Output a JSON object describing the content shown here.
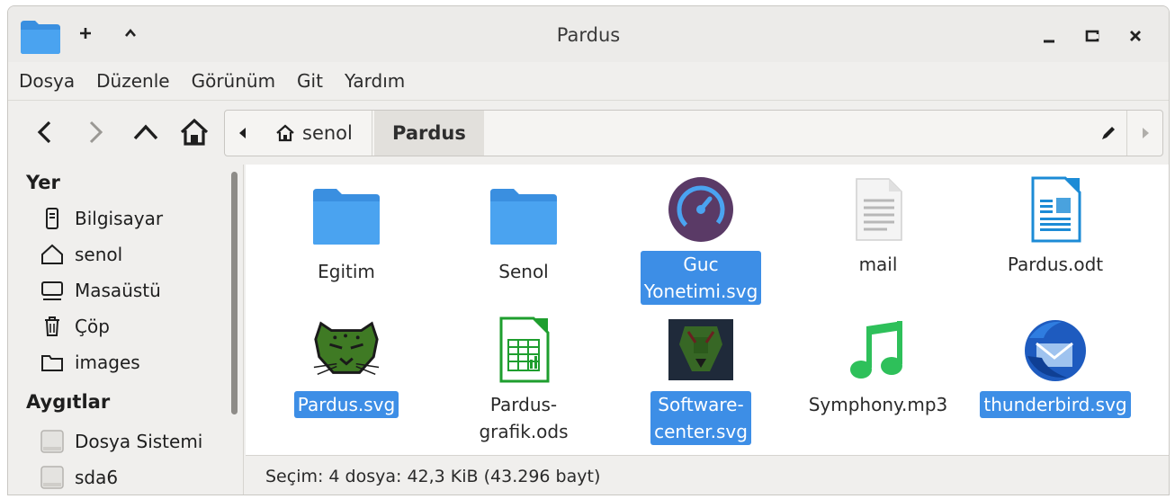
{
  "window": {
    "title": "Pardus",
    "new_tab_label": "+",
    "up_label": "^"
  },
  "menu": [
    "Dosya",
    "Düzenle",
    "Görünüm",
    "Git",
    "Yardım"
  ],
  "pathbar": {
    "crumbs": [
      {
        "label": "senol",
        "icon": "home-icon"
      },
      {
        "label": "Pardus",
        "active": true
      }
    ]
  },
  "sidebar": {
    "sections": [
      {
        "title": "Yer",
        "items": [
          {
            "label": "Bilgisayar",
            "icon": "computer-icon"
          },
          {
            "label": "senol",
            "icon": "home-icon"
          },
          {
            "label": "Masaüstü",
            "icon": "desktop-icon"
          },
          {
            "label": "Çöp",
            "icon": "trash-icon"
          },
          {
            "label": "images",
            "icon": "folder-icon"
          }
        ]
      },
      {
        "title": "Aygıtlar",
        "items": [
          {
            "label": "Dosya Sistemi",
            "icon": "drive-icon"
          },
          {
            "label": "sda6",
            "icon": "drive-icon"
          }
        ]
      }
    ]
  },
  "files": [
    {
      "name": "Egitim",
      "type": "folder",
      "selected": false
    },
    {
      "name": "Senol",
      "type": "folder",
      "selected": false
    },
    {
      "name": "Guc Yonetimi.svg",
      "line1": "Guc",
      "line2": "Yonetimi.svg",
      "type": "gauge",
      "selected": true
    },
    {
      "name": "mail",
      "type": "text",
      "selected": false
    },
    {
      "name": "Pardus.odt",
      "type": "writer",
      "selected": false
    },
    {
      "name": "Pardus.svg",
      "type": "panther",
      "selected": true
    },
    {
      "name": "Pardus-grafik.ods",
      "line1": "Pardus-",
      "line2": "grafik.ods",
      "type": "calc",
      "selected": false
    },
    {
      "name": "Software-center.svg",
      "line1": "Software-",
      "line2": "center.svg",
      "type": "software",
      "selected": true
    },
    {
      "name": "Symphony.mp3",
      "type": "music",
      "selected": false
    },
    {
      "name": "thunderbird.svg",
      "type": "thunderbird",
      "selected": true
    }
  ],
  "status": "Seçim: 4 dosya: 42,3 KiB (43.296 bayt)",
  "colors": {
    "accent": "#3d8ee6",
    "folder": "#4a9ee8"
  }
}
